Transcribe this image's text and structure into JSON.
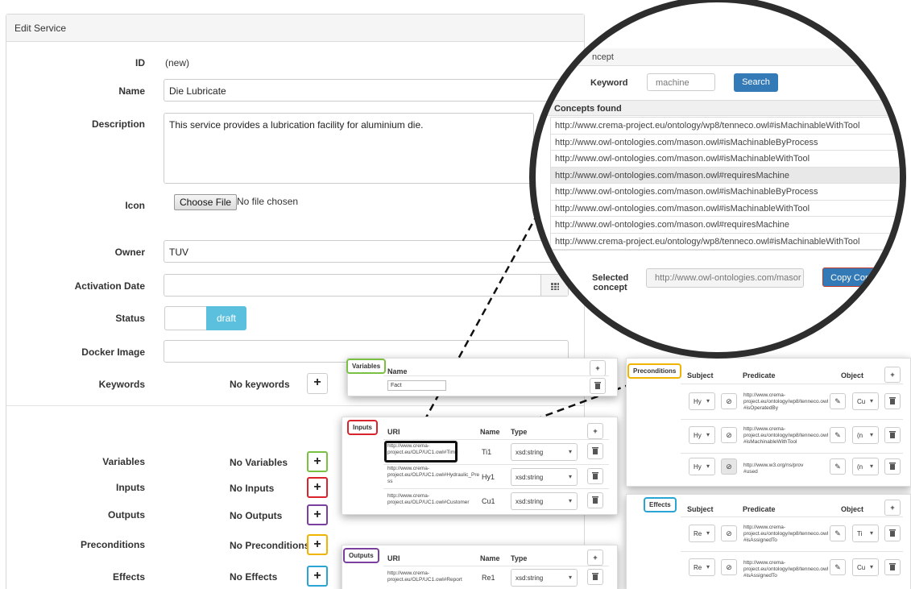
{
  "form": {
    "header": "Edit Service",
    "id_label": "ID",
    "id_value": "(new)",
    "name_label": "Name",
    "name_value": "Die Lubricate",
    "description_label": "Description",
    "description_value": "This service provides a lubrication facility for aluminium die.",
    "icon_label": "Icon",
    "choose_file": "Choose File",
    "no_file": "No file chosen",
    "owner_label": "Owner",
    "owner_value": "TUV",
    "activation_label": "Activation Date",
    "activation_value": "",
    "status_label": "Status",
    "status_value": "draft",
    "docker_label": "Docker Image",
    "docker_value": "",
    "keywords_label": "Keywords",
    "keywords_value": "No keywords",
    "variables_label": "Variables",
    "variables_value": "No Variables",
    "inputs_label": "Inputs",
    "inputs_value": "No Inputs",
    "outputs_label": "Outputs",
    "outputs_value": "No Outputs",
    "preconditions_label": "Preconditions",
    "preconditions_value": "No Preconditions",
    "effects_label": "Effects",
    "effects_value": "No Effects",
    "plus": "+"
  },
  "concept": {
    "panel_title": "ncept",
    "keyword_label": "Keyword",
    "keyword_value": "machine",
    "search_button": "Search",
    "found_label": "Concepts found",
    "found": [
      "http://www.crema-project.eu/ontology/wp8/tenneco.owl#isMachinableWithTool",
      "http://www.owl-ontologies.com/mason.owl#isMachinableByProcess",
      "http://www.owl-ontologies.com/mason.owl#isMachinableWithTool",
      "http://www.owl-ontologies.com/mason.owl#requiresMachine",
      "http://www.owl-ontologies.com/mason.owl#isMachinableByProcess",
      "http://www.owl-ontologies.com/mason.owl#isMachinableWithTool",
      "http://www.owl-ontologies.com/mason.owl#requiresMachine",
      "http://www.crema-project.eu/ontology/wp8/tenneco.owl#isMachinableWithTool"
    ],
    "selected_label_1": "Selected",
    "selected_label_2": "concept",
    "selected_value": "http://www.owl-ontologies.com/masor",
    "copy_button": "Copy Concept"
  },
  "variables_popup": {
    "tag": "Variables",
    "col_name": "Name",
    "row_value": "Fact"
  },
  "inputs_popup": {
    "tag": "Inputs",
    "col_uri": "URI",
    "col_name": "Name",
    "col_type": "Type",
    "rows": [
      {
        "uri1": "http://www.crema-",
        "uri2": "project.eu/OLP/UC1.owl#Time",
        "name": "Ti1",
        "type": "xsd:string"
      },
      {
        "uri1": "http://www.crema-",
        "uri2": "project.eu/OLP/UC1.owl#Hydraulic_Pre",
        "uri3": "ss",
        "name": "Hy1",
        "type": "xsd:string"
      },
      {
        "uri1": "http://www.crema-",
        "uri2": "project.eu/OLP/UC1.owl#Customer",
        "name": "Cu1",
        "type": "xsd:string"
      }
    ]
  },
  "outputs_popup": {
    "tag": "Outputs",
    "col_uri": "URI",
    "col_name": "Name",
    "col_type": "Type",
    "rows": [
      {
        "uri1": "http://www.crema-",
        "uri2": "project.eu/OLP/UC1.owl#Report",
        "name": "Re1",
        "type": "xsd:string"
      }
    ]
  },
  "preconditions_popup": {
    "tag": "Preconditions",
    "col_subject": "Subject",
    "col_predicate": "Predicate",
    "col_object": "Object",
    "rows": [
      {
        "subject": "Hy",
        "p1": "http://www.crema-",
        "p2": "project.eu/ontology/wp8/tenneco.owl",
        "p3": "#isOperatedBy",
        "object": "Cu"
      },
      {
        "subject": "Hy",
        "p1": "http://www.crema-",
        "p2": "project.eu/ontology/wp8/tenneco.owl",
        "p3": "#isMachinableWithTool",
        "object": "(n"
      },
      {
        "subject": "Hy",
        "p1": "http://www.w3.org/ns/prov",
        "p2": "#used",
        "p3": "",
        "object": "(n"
      }
    ]
  },
  "effects_popup": {
    "tag": "Effects",
    "col_subject": "Subject",
    "col_predicate": "Predicate",
    "col_object": "Object",
    "rows": [
      {
        "subject": "Re",
        "p1": "http://www.crema-",
        "p2": "project.eu/ontology/wp8/tenneco.owl",
        "p3": "#isAssignedTo",
        "object": "Ti"
      },
      {
        "subject": "Re",
        "p1": "http://www.crema-",
        "p2": "project.eu/ontology/wp8/tenneco.owl",
        "p3": "#isAssignedTo",
        "object": "Cu"
      }
    ]
  },
  "colors": {
    "variables": "#7ac143",
    "inputs": "#d9232d",
    "outputs": "#7b3fa0",
    "preconditions": "#f0b400",
    "effects": "#2aa4d5",
    "primary": "#337ab7",
    "status": "#5bc0de"
  }
}
